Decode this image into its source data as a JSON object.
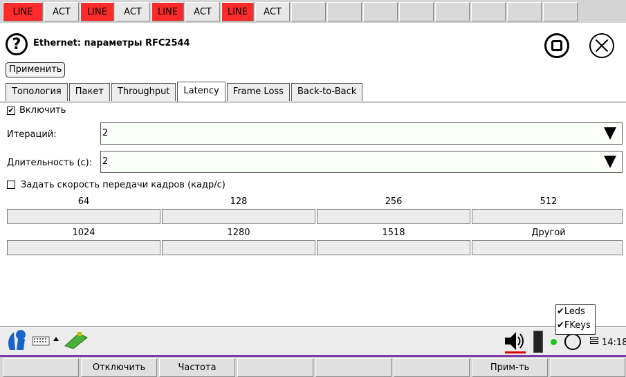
{
  "ledbar": {
    "items": [
      {
        "label": "LINE",
        "state": "red"
      },
      {
        "label": "ACT",
        "state": "gray"
      },
      {
        "label": "LINE",
        "state": "red"
      },
      {
        "label": "ACT",
        "state": "gray"
      },
      {
        "label": "LINE",
        "state": "red"
      },
      {
        "label": "ACT",
        "state": "gray"
      },
      {
        "label": "LINE",
        "state": "red"
      },
      {
        "label": "ACT",
        "state": "gray"
      }
    ]
  },
  "header": {
    "title": "Ethernet: параметры RFC2544",
    "help_icon": "?"
  },
  "apply_label": "Применить",
  "tabs": [
    {
      "label": "Топология",
      "active": false
    },
    {
      "label": "Пакет",
      "active": false
    },
    {
      "label": "Throughput",
      "active": false
    },
    {
      "label": "Latency",
      "active": true
    },
    {
      "label": "Frame Loss",
      "active": false
    },
    {
      "label": "Back-to-Back",
      "active": false
    }
  ],
  "form": {
    "enable_label": "Включить",
    "enable_checked": "✔",
    "iterations_label": "Итераций:",
    "iterations_value": "2",
    "duration_label": "Длительность (с):",
    "duration_value": "2",
    "speed_label": "Задать скорость передачи кадров (кадр/с)",
    "speed_checked": ""
  },
  "frame_sizes": {
    "row1": [
      "64",
      "128",
      "256",
      "512"
    ],
    "row2": [
      "1024",
      "1280",
      "1518",
      "Другой"
    ]
  },
  "options_popup": {
    "leds": "✔Leds",
    "fkeys": "✔FKeys"
  },
  "taskbar": {
    "time": "14:18"
  },
  "fkeys": [
    "",
    "Отключить",
    "Частота",
    "",
    "",
    "",
    "Прим-ть",
    ""
  ],
  "colors": {
    "led_red": "#ff2a2a",
    "dock_accent": "#7b3aa8"
  }
}
